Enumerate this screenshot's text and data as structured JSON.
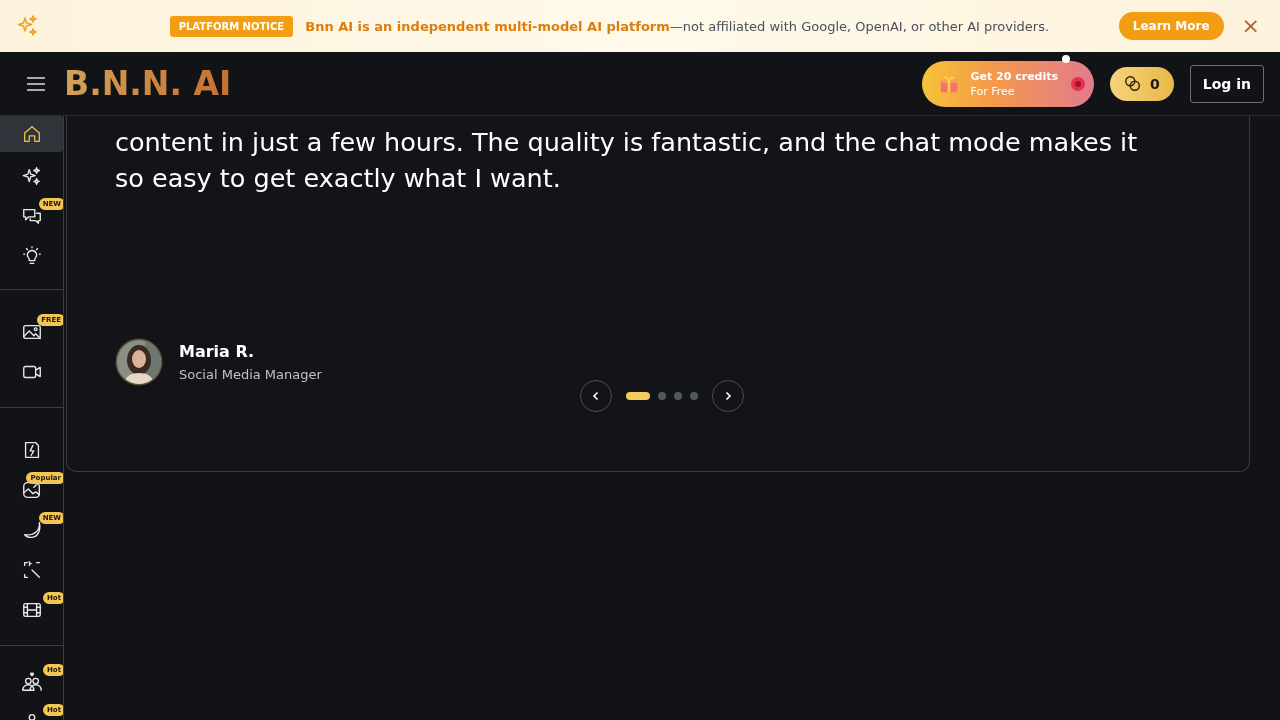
{
  "notice_bar": {
    "badge": "PLATFORM NOTICE",
    "message": "**Bnn AI is an independent multi-model AI platform**—not affiliated with Google, OpenAI, or other AI providers.",
    "button": "Learn More",
    "close": "×"
  },
  "header": {
    "logo": "B.N.N. AI",
    "promo": {
      "title": "Get 20 credits",
      "subtitle": "For Free"
    },
    "credits": "0",
    "login": "Log in"
  },
  "sidebar": {
    "groups": [
      [
        {
          "selected": true
        },
        {
          "selected": false
        },
        {
          "selected": false,
          "badge": "NEW"
        },
        {
          "selected": false
        }
      ],
      [
        {
          "selected": false,
          "badge": "FREE"
        },
        {
          "selected": false
        }
      ],
      [
        {
          "selected": false
        },
        {
          "selected": false,
          "badge": "Popular"
        },
        {
          "selected": false,
          "badge": "NEW"
        },
        {
          "selected": false
        },
        {
          "selected": false,
          "badge": "Hot"
        }
      ],
      [
        {
          "selected": false,
          "badge": "Hot"
        },
        {
          "selected": false,
          "badge": "Hot"
        }
      ]
    ]
  },
  "testimonial": {
    "quote": "content in just a few hours. The quality is fantastic, and the chat mode makes it so easy to get exactly what I want.",
    "author": "Maria R.",
    "role": "Social Media Manager",
    "dots": [
      {
        "selected": true
      },
      {
        "selected": false
      },
      {
        "selected": false
      },
      {
        "selected": false
      }
    ]
  }
}
